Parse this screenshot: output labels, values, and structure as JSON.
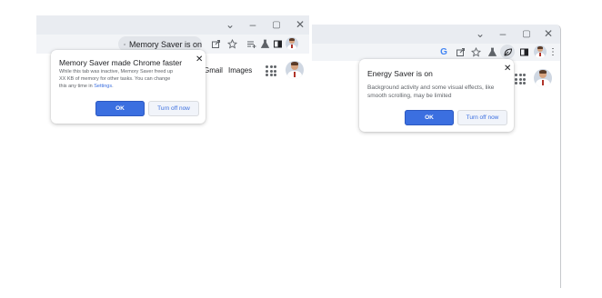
{
  "left_window": {
    "controls": {
      "minimize": "–",
      "maximize": "▢",
      "close": "✕",
      "collapse": "⌄"
    },
    "toolbar": {
      "memory_saver_chip": "Memory Saver is on"
    },
    "page": {
      "gmail": "Gmail",
      "images": "Images"
    },
    "bubble": {
      "title": "Memory Saver made Chrome faster",
      "body_line1": "While this tab was inactive, Memory Saver freed up",
      "body_line2": "XX KB of memory for other tasks. You can change",
      "body_line3_prefix": "this any time in ",
      "body_link": "Settings",
      "body_line3_suffix": ".",
      "ok_label": "OK",
      "turn_off_label": "Turn off now",
      "close": "✕"
    }
  },
  "right_window": {
    "controls": {
      "minimize": "–",
      "maximize": "▢",
      "close": "✕",
      "collapse": "⌄"
    },
    "toolbar": {
      "g": "G",
      "menu": "⋮"
    },
    "bubble": {
      "title": "Energy Saver is on",
      "body_line1": "Background activity and some visual effects, like",
      "body_line2": "smooth scrolling, may be limited",
      "ok_label": "OK",
      "turn_off_label": "Turn off now",
      "close": "✕"
    }
  },
  "colors": {
    "accent": "#3b6fe0",
    "titlebar": "#e9ecf1",
    "toolbar": "#f2f4f7"
  }
}
